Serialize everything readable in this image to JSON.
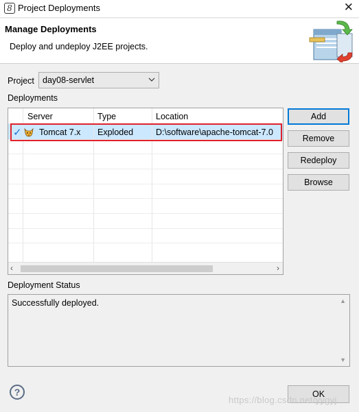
{
  "window": {
    "title": "Project Deployments",
    "close_glyph": "✕"
  },
  "banner": {
    "title": "Manage Deployments",
    "description": "Deploy and undeploy J2EE projects."
  },
  "project": {
    "label": "Project",
    "selected": "day08-servlet"
  },
  "deployments": {
    "label": "Deployments",
    "columns": [
      "Server",
      "Type",
      "Location"
    ],
    "rows": [
      {
        "status_icon": "check-icon",
        "server": "Tomcat  7.x",
        "type": "Exploded",
        "location": "D:\\software\\apache-tomcat-7.0"
      }
    ]
  },
  "buttons": {
    "add": "Add",
    "remove": "Remove",
    "redeploy": "Redeploy",
    "browse": "Browse",
    "ok": "OK"
  },
  "status": {
    "label": "Deployment Status",
    "text": "Successfully deployed."
  },
  "watermark": "https://blog.csdn.net/yygyj",
  "colors": {
    "selection": "#cce8ff",
    "highlight_border": "#e0202b",
    "default_button_border": "#0078d7"
  }
}
